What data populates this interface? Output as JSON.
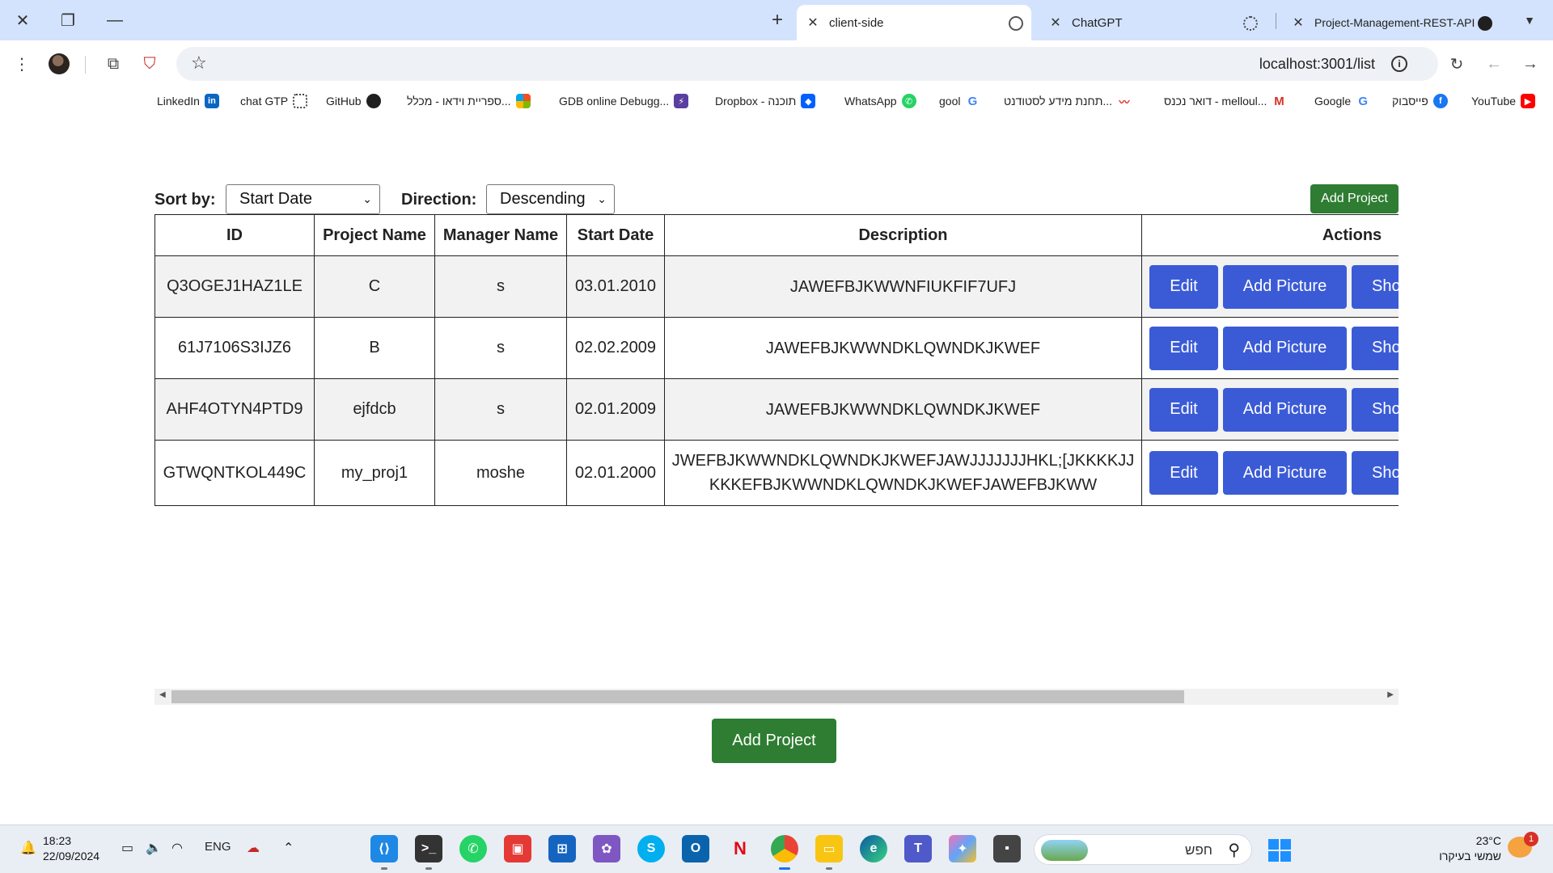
{
  "browser": {
    "tabs": [
      {
        "title": "client-side",
        "active": true
      },
      {
        "title": "ChatGPT",
        "active": false
      },
      {
        "title": "Project-Management-REST-API",
        "active": false
      }
    ],
    "url": "localhost:3001/list",
    "bookmarks": [
      {
        "label": "YouTube",
        "icon": "youtube-icon",
        "color": "#ff0000"
      },
      {
        "label": "פייסבוק",
        "icon": "facebook-icon",
        "color": "#1877f2"
      },
      {
        "label": "Google",
        "icon": "google-icon",
        "color": "#4285f4"
      },
      {
        "label": "דואר נכנס - melloul...",
        "icon": "gmail-icon",
        "color": "#d93025"
      },
      {
        "label": "תחנת מידע לסטודנט...",
        "icon": "student-portal-icon",
        "color": "#d93025"
      },
      {
        "label": "gool",
        "icon": "google-icon",
        "color": "#4285f4"
      },
      {
        "label": "WhatsApp",
        "icon": "whatsapp-icon",
        "color": "#25d366"
      },
      {
        "label": "Dropbox - תוכנה",
        "icon": "dropbox-icon",
        "color": "#0061ff"
      },
      {
        "label": "GDB online Debugg...",
        "icon": "gdb-icon",
        "color": "#5b3fa0"
      },
      {
        "label": "ספריית וידאו - מכלל...",
        "icon": "microsoft-icon",
        "color": "#f25022"
      },
      {
        "label": "GitHub",
        "icon": "github-icon",
        "color": "#1f1f1f"
      },
      {
        "label": "chat GTP",
        "icon": "chatgpt-icon",
        "color": "#444444"
      },
      {
        "label": "LinkedIn",
        "icon": "linkedin-icon",
        "color": "#0a66c2"
      }
    ]
  },
  "controls": {
    "sort_label": "Sort by:",
    "sort_value": "Start Date",
    "direction_label": "Direction:",
    "direction_value": "Descending",
    "add_project_top": "Add Project"
  },
  "table": {
    "headers": [
      "ID",
      "Project Name",
      "Manager Name",
      "Start Date",
      "Description",
      "Actions"
    ],
    "rows": [
      {
        "id": "Q3OGEJ1HAZ1LE",
        "name": "C",
        "manager": "s",
        "start": "03.01.2010",
        "desc": "JAWEFBJKWWNFIUKFIF7UFJ"
      },
      {
        "id": "61J7106S3IJZ6",
        "name": "B",
        "manager": "s",
        "start": "02.02.2009",
        "desc": "JAWEFBJKWWNDKLQWNDKJKWEF"
      },
      {
        "id": "AHF4OTYN4PTD9",
        "name": "ejfdcb",
        "manager": "s",
        "start": "02.01.2009",
        "desc": "JAWEFBJKWWNDKLQWNDKJKWEF"
      },
      {
        "id": "GTWQNTKOL449C",
        "name": "my_proj1",
        "manager": "moshe",
        "start": "02.01.2000",
        "desc": "JWEFBJKWWNDKLQWNDKJKWEFJAWJJJJJJJHKL;[JKKKKJJKKKEFBJKWWNDKLQWNDKJKWEFJAWEFBJKWW"
      }
    ],
    "action_labels": {
      "edit": "Edit",
      "add_picture": "Add Picture",
      "show": "Show"
    }
  },
  "footer": {
    "add_project": "Add Project"
  },
  "taskbar": {
    "time": "18:23",
    "date": "22/09/2024",
    "language": "ENG",
    "search_placeholder": "חפש",
    "temperature": "23°C",
    "weather_text": "שמשי בעיקרו",
    "notification_count": "1"
  },
  "colors": {
    "primary_button": "#3b5bd6",
    "success_button": "#2e7d32",
    "tab_strip": "#d3e3fd"
  }
}
